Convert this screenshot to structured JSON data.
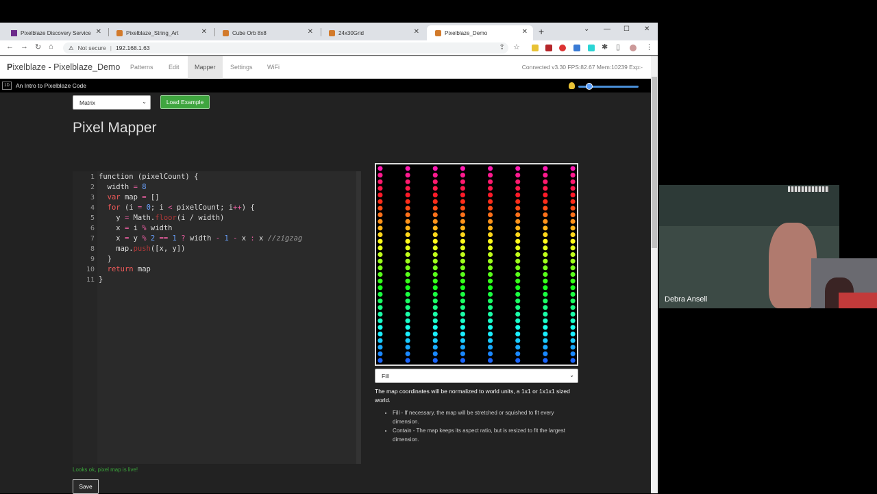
{
  "browser": {
    "tabs": [
      {
        "label": "Pixelblaze Discovery Service",
        "favicon_color": "#6b2a8a"
      },
      {
        "label": "Pixelblaze_String_Art",
        "favicon_color": "#d27a2b"
      },
      {
        "label": "Cube Orb 8x8",
        "favicon_color": "#d27a2b"
      },
      {
        "label": "24x30Grid",
        "favicon_color": "#d27a2b"
      },
      {
        "label": "Pixelblaze_Demo",
        "favicon_color": "#d27a2b",
        "active": true
      }
    ],
    "new_tab": "+",
    "security": "Not secure",
    "url": "192.168.1.63"
  },
  "app": {
    "logo": "ixelblaze - Pixelblaze_Demo",
    "logo_mark": "P",
    "nav": [
      "Patterns",
      "Edit",
      "Mapper",
      "Settings",
      "WiFi"
    ],
    "active_nav": "Mapper",
    "status": "Connected v3.30 FPS:82.67 Mem:10239 Exp:-"
  },
  "pattern_bar": {
    "badge": "1D",
    "name": "An Intro to Pixelblaze Code",
    "brightness_fraction": 0.13
  },
  "mapper": {
    "example_select": "Matrix",
    "load_button": "Load Example",
    "title": "Pixel Mapper",
    "code_lines": [
      "function (pixelCount) {",
      "  width = 8",
      "  var map = []",
      "  for (i = 0; i < pixelCount; i++) {",
      "    y = Math.floor(i / width)",
      "    x = i % width",
      "    x = y % 2 == 1 ? width - 1 - x : x //zigzag",
      "    map.push([x, y])",
      "  }",
      "  return map",
      "}"
    ],
    "line_numbers": [
      "1",
      "2",
      "3",
      "4",
      "5",
      "6",
      "7",
      "8",
      "9",
      "10",
      "11"
    ],
    "preview": {
      "columns": 8,
      "rows": 30
    },
    "fill_select": "Fill",
    "description": "The map coordinates will be normalized to world units, a 1x1 or 1x1x1 sized world.",
    "options": [
      "Fill - If necessary, the map will be stretched or squished to fit every dimension.",
      "Contain - The map keeps its aspect ratio, but is resized to fit the largest dimension."
    ],
    "status_msg": "Looks ok, pixel map is live!",
    "save_button": "Save"
  },
  "video": {
    "participant": "Debra Ansell"
  }
}
